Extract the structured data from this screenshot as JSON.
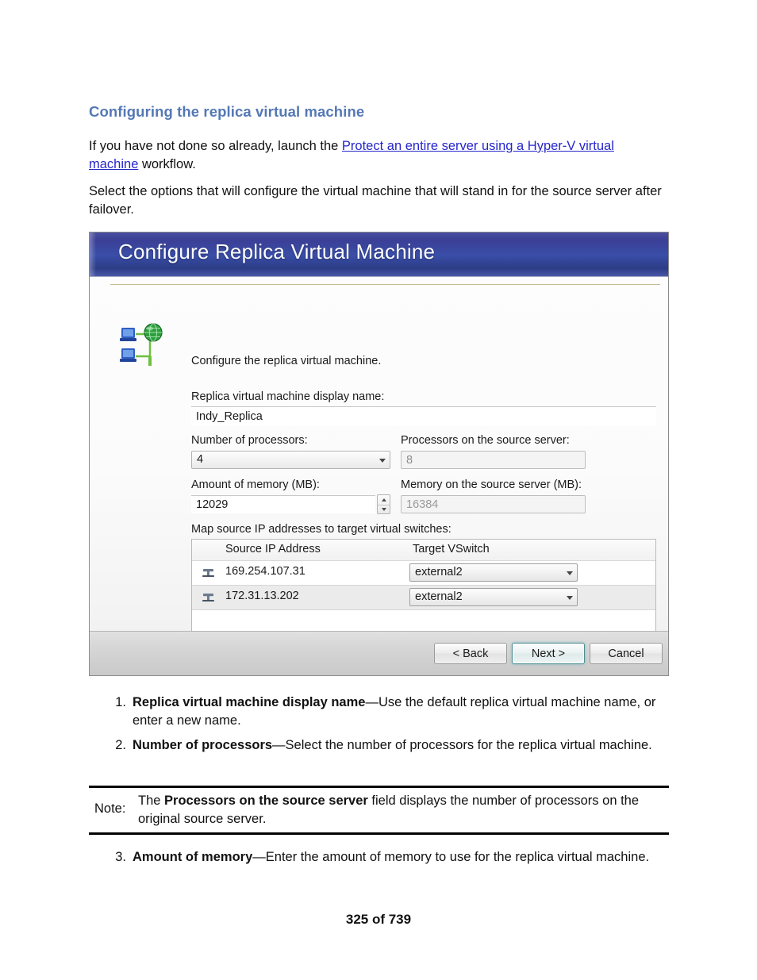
{
  "document": {
    "heading": "Configuring the replica virtual machine",
    "paragraph_1_pre": "If you have not done so already, launch the ",
    "paragraph_1_link": "Protect an entire server using a Hyper-V virtual machine",
    "paragraph_1_post": " workflow.",
    "paragraph_2": "Select the options that will configure the virtual machine that will stand in for the source server after failover.",
    "heading_color": "#5478b5",
    "link_color": "#2626cc"
  },
  "dialog": {
    "title": "Configure Replica Virtual Machine",
    "titlebar_color": "#3a4ea8",
    "intro": "Configure the replica virtual machine.",
    "icon_name": "server-network-icon",
    "fields": {
      "display_name_label": "Replica virtual machine display name:",
      "display_name_value": "Indy_Replica",
      "num_processors_label": "Number of processors:",
      "num_processors_value": "4",
      "source_processors_label": "Processors on the source server:",
      "source_processors_value": "8",
      "amount_memory_label": "Amount of memory (MB):",
      "amount_memory_value": "12029",
      "source_memory_label": "Memory on the source server (MB):",
      "source_memory_value": "16384"
    },
    "map_section": {
      "label": "Map source IP addresses to target virtual switches:",
      "columns": [
        "Source IP Address",
        "Target VSwitch"
      ],
      "rows": [
        {
          "ip": "169.254.107.31",
          "vswitch": "external2"
        },
        {
          "ip": "172.31.13.202",
          "vswitch": "external2"
        }
      ]
    },
    "buttons": {
      "back": "< Back",
      "next": "Next >",
      "cancel": "Cancel"
    }
  },
  "steps": [
    {
      "number": "1.",
      "term": "Replica virtual machine display name",
      "dash": "—",
      "description": "Use the default replica virtual machine name, or enter a new name."
    },
    {
      "number": "2.",
      "term": "Number of processors",
      "dash": "—",
      "description": "Select the number of processors for the replica virtual machine."
    },
    {
      "number": "3.",
      "term": "Amount of memory",
      "dash": "—",
      "description": "Enter the amount of memory to use for the replica virtual machine."
    }
  ],
  "note": {
    "label": "Note:",
    "text_pre": "The ",
    "text_bold": "Processors on the source server",
    "text_post": " field displays the number of processors on the original source server."
  },
  "footer": {
    "page_number": "325 of 739"
  }
}
